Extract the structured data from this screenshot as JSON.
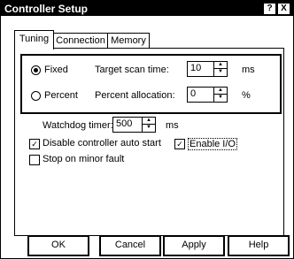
{
  "window": {
    "title": "Controller Setup",
    "help_btn": "?",
    "close_btn": "X"
  },
  "tabs": [
    {
      "label": "Tuning",
      "active": true
    },
    {
      "label": "Connection",
      "active": false
    },
    {
      "label": "Memory",
      "active": false
    }
  ],
  "scan_mode": {
    "fixed_label": "Fixed",
    "percent_label": "Percent",
    "selected": "fixed",
    "target_scan_label": "Target scan time:",
    "target_scan_value": "10",
    "target_scan_unit": "ms",
    "percent_alloc_label": "Percent allocation:",
    "percent_alloc_value": "0",
    "percent_alloc_unit": "%"
  },
  "watchdog": {
    "label": "Watchdog timer:",
    "value": "500",
    "unit": "ms"
  },
  "checkboxes": {
    "disable_auto_start": {
      "label": "Disable controller auto start",
      "checked": true
    },
    "enable_io": {
      "label": "Enable I/O",
      "checked": true
    },
    "stop_minor_fault": {
      "label": "Stop on minor fault",
      "checked": false
    }
  },
  "buttons": {
    "ok": "OK",
    "cancel": "Cancel",
    "apply": "Apply",
    "help": "Help"
  },
  "glyphs": {
    "check": "✓",
    "up": "▲",
    "down": "▼"
  }
}
